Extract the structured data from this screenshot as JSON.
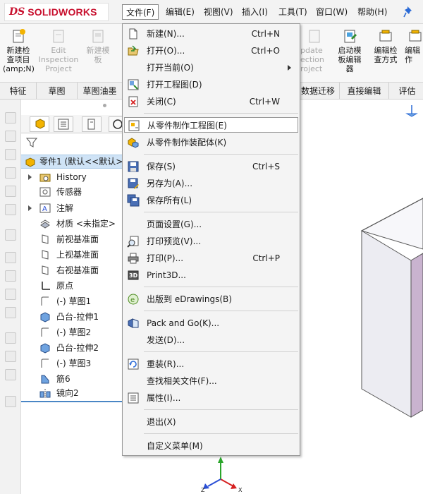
{
  "app": {
    "logo_ds": "DS",
    "logo_text": "SOLIDWORKS"
  },
  "menubar": {
    "items": [
      {
        "label": "文件(F)"
      },
      {
        "label": "编辑(E)"
      },
      {
        "label": "视图(V)"
      },
      {
        "label": "插入(I)"
      },
      {
        "label": "工具(T)"
      },
      {
        "label": "窗口(W)"
      },
      {
        "label": "帮助(H)"
      }
    ]
  },
  "ribbon": {
    "new_check": "新建检\n查项目\n(amp;N)",
    "edit_inspection": "Edit\nInspection\nProject",
    "new_template": "新建模\n板",
    "update_inspection": "pdate\nection\nroject",
    "launch_template": "启动模\n板编辑\n器",
    "edit_check": "编辑检\n查方式",
    "edit_more": "编辑\n作"
  },
  "tabs": {
    "items": [
      {
        "label": "特征"
      },
      {
        "label": "草图"
      },
      {
        "label": "草图油墨"
      },
      {
        "label": "数据迁移"
      },
      {
        "label": "直接编辑"
      },
      {
        "label": "评估"
      }
    ]
  },
  "feature_tree": {
    "root": "零件1 (默认<<默认>",
    "items": [
      {
        "label": "History"
      },
      {
        "label": "传感器"
      },
      {
        "label": "注解"
      },
      {
        "label": "材质 <未指定>"
      },
      {
        "label": "前视基准面"
      },
      {
        "label": "上视基准面"
      },
      {
        "label": "右视基准面"
      },
      {
        "label": "原点"
      },
      {
        "label": "(-) 草图1"
      },
      {
        "label": "凸台-拉伸1"
      },
      {
        "label": "(-) 草图2"
      },
      {
        "label": "凸台-拉伸2"
      },
      {
        "label": "(-) 草图3"
      },
      {
        "label": "筋6"
      },
      {
        "label": "镜向2"
      }
    ]
  },
  "file_menu": {
    "new": {
      "label": "新建(N)...",
      "shortcut": "Ctrl+N"
    },
    "open": {
      "label": "打开(O)...",
      "shortcut": "Ctrl+O"
    },
    "open_current": {
      "label": "打开当前(O)"
    },
    "open_drawing": {
      "label": "打开工程图(D)"
    },
    "close": {
      "label": "关闭(C)",
      "shortcut": "Ctrl+W"
    },
    "make_drawing": {
      "label": "从零件制作工程图(E)"
    },
    "make_assembly": {
      "label": "从零件制作装配体(K)"
    },
    "save": {
      "label": "保存(S)",
      "shortcut": "Ctrl+S"
    },
    "save_as": {
      "label": "另存为(A)..."
    },
    "save_all": {
      "label": "保存所有(L)"
    },
    "page_setup": {
      "label": "页面设置(G)..."
    },
    "print_preview": {
      "label": "打印预览(V)..."
    },
    "print": {
      "label": "打印(P)...",
      "shortcut": "Ctrl+P"
    },
    "print3d": {
      "label": "Print3D..."
    },
    "publish": {
      "label": "出版到 eDrawings(B)"
    },
    "pack_go": {
      "label": "Pack and Go(K)..."
    },
    "send": {
      "label": "发送(D)..."
    },
    "reload": {
      "label": "重装(R)..."
    },
    "find_refs": {
      "label": "查找相关文件(F)..."
    },
    "properties": {
      "label": "属性(I)..."
    },
    "exit": {
      "label": "退出(X)"
    },
    "customize": {
      "label": "自定义菜单(M)"
    }
  },
  "colors": {
    "brand": "#c8102e",
    "selection": "#cfe3f6",
    "axis_x": "#d62020",
    "axis_y": "#2aa52a",
    "axis_z": "#2a4fd6"
  }
}
